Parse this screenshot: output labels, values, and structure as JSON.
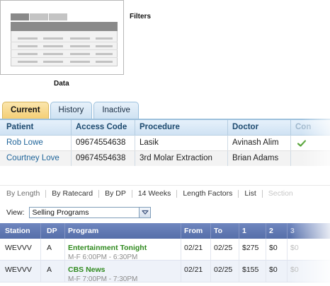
{
  "thumbnail": {
    "filters_label": "Filters",
    "data_label": "Data"
  },
  "patient_tabs": [
    {
      "label": "Current",
      "active": true
    },
    {
      "label": "History",
      "active": false
    },
    {
      "label": "Inactive",
      "active": false
    }
  ],
  "patient_table": {
    "columns": [
      "Patient",
      "Access Code",
      "Procedure",
      "Doctor",
      "Con"
    ],
    "rows": [
      {
        "patient": "Rob Lowe",
        "access_code": "09674554638",
        "procedure": "Lasik",
        "doctor": "Avinash Alim",
        "confirmed": true
      },
      {
        "patient": "Courtney Love",
        "access_code": "09674554638",
        "procedure": "3rd Molar Extraction",
        "doctor": "Brian Adams",
        "confirmed": false
      }
    ]
  },
  "view_links": [
    "By Length",
    "By Ratecard",
    "By DP",
    "14 Weeks",
    "Length Factors",
    "List",
    "Section"
  ],
  "view_select": {
    "label": "View:",
    "value": "Selling Programs"
  },
  "ratecard_table": {
    "columns": [
      "Station",
      "DP",
      "Program",
      "From",
      "To",
      "1",
      "2",
      "3"
    ],
    "rows": [
      {
        "station": "WEVVV",
        "dp": "A",
        "program": "Entertainment Tonight",
        "time": "M-F 6:00PM - 6:30PM",
        "from": "02/21",
        "to": "02/25",
        "w1": "$275",
        "w2": "$0",
        "w3": "$0"
      },
      {
        "station": "WEVVV",
        "dp": "A",
        "program": "CBS News",
        "time": "M-F 7:00PM - 7:30PM",
        "from": "02/21",
        "to": "02/25",
        "w1": "$155",
        "w2": "$0",
        "w3": "$0"
      }
    ]
  },
  "colors": {
    "active_tab": "#f4cf75",
    "tab_blue": "#cfe2f2",
    "link": "#20659a",
    "ratecard_header": "#556ea9",
    "program_green": "#2f8a1e",
    "check_green": "#5aa63c"
  },
  "icons": {
    "confirmed": "checkmark-icon",
    "select": "chevron-down-icon"
  }
}
